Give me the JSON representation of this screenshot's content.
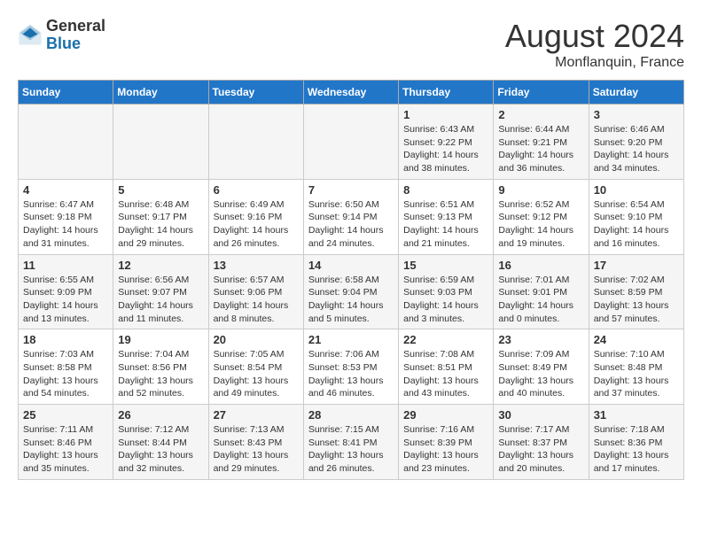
{
  "header": {
    "logo_general": "General",
    "logo_blue": "Blue",
    "month_year": "August 2024",
    "location": "Monflanquin, France"
  },
  "weekdays": [
    "Sunday",
    "Monday",
    "Tuesday",
    "Wednesday",
    "Thursday",
    "Friday",
    "Saturday"
  ],
  "weeks": [
    [
      {
        "day": "",
        "detail": ""
      },
      {
        "day": "",
        "detail": ""
      },
      {
        "day": "",
        "detail": ""
      },
      {
        "day": "",
        "detail": ""
      },
      {
        "day": "1",
        "detail": "Sunrise: 6:43 AM\nSunset: 9:22 PM\nDaylight: 14 hours\nand 38 minutes."
      },
      {
        "day": "2",
        "detail": "Sunrise: 6:44 AM\nSunset: 9:21 PM\nDaylight: 14 hours\nand 36 minutes."
      },
      {
        "day": "3",
        "detail": "Sunrise: 6:46 AM\nSunset: 9:20 PM\nDaylight: 14 hours\nand 34 minutes."
      }
    ],
    [
      {
        "day": "4",
        "detail": "Sunrise: 6:47 AM\nSunset: 9:18 PM\nDaylight: 14 hours\nand 31 minutes."
      },
      {
        "day": "5",
        "detail": "Sunrise: 6:48 AM\nSunset: 9:17 PM\nDaylight: 14 hours\nand 29 minutes."
      },
      {
        "day": "6",
        "detail": "Sunrise: 6:49 AM\nSunset: 9:16 PM\nDaylight: 14 hours\nand 26 minutes."
      },
      {
        "day": "7",
        "detail": "Sunrise: 6:50 AM\nSunset: 9:14 PM\nDaylight: 14 hours\nand 24 minutes."
      },
      {
        "day": "8",
        "detail": "Sunrise: 6:51 AM\nSunset: 9:13 PM\nDaylight: 14 hours\nand 21 minutes."
      },
      {
        "day": "9",
        "detail": "Sunrise: 6:52 AM\nSunset: 9:12 PM\nDaylight: 14 hours\nand 19 minutes."
      },
      {
        "day": "10",
        "detail": "Sunrise: 6:54 AM\nSunset: 9:10 PM\nDaylight: 14 hours\nand 16 minutes."
      }
    ],
    [
      {
        "day": "11",
        "detail": "Sunrise: 6:55 AM\nSunset: 9:09 PM\nDaylight: 14 hours\nand 13 minutes."
      },
      {
        "day": "12",
        "detail": "Sunrise: 6:56 AM\nSunset: 9:07 PM\nDaylight: 14 hours\nand 11 minutes."
      },
      {
        "day": "13",
        "detail": "Sunrise: 6:57 AM\nSunset: 9:06 PM\nDaylight: 14 hours\nand 8 minutes."
      },
      {
        "day": "14",
        "detail": "Sunrise: 6:58 AM\nSunset: 9:04 PM\nDaylight: 14 hours\nand 5 minutes."
      },
      {
        "day": "15",
        "detail": "Sunrise: 6:59 AM\nSunset: 9:03 PM\nDaylight: 14 hours\nand 3 minutes."
      },
      {
        "day": "16",
        "detail": "Sunrise: 7:01 AM\nSunset: 9:01 PM\nDaylight: 14 hours\nand 0 minutes."
      },
      {
        "day": "17",
        "detail": "Sunrise: 7:02 AM\nSunset: 8:59 PM\nDaylight: 13 hours\nand 57 minutes."
      }
    ],
    [
      {
        "day": "18",
        "detail": "Sunrise: 7:03 AM\nSunset: 8:58 PM\nDaylight: 13 hours\nand 54 minutes."
      },
      {
        "day": "19",
        "detail": "Sunrise: 7:04 AM\nSunset: 8:56 PM\nDaylight: 13 hours\nand 52 minutes."
      },
      {
        "day": "20",
        "detail": "Sunrise: 7:05 AM\nSunset: 8:54 PM\nDaylight: 13 hours\nand 49 minutes."
      },
      {
        "day": "21",
        "detail": "Sunrise: 7:06 AM\nSunset: 8:53 PM\nDaylight: 13 hours\nand 46 minutes."
      },
      {
        "day": "22",
        "detail": "Sunrise: 7:08 AM\nSunset: 8:51 PM\nDaylight: 13 hours\nand 43 minutes."
      },
      {
        "day": "23",
        "detail": "Sunrise: 7:09 AM\nSunset: 8:49 PM\nDaylight: 13 hours\nand 40 minutes."
      },
      {
        "day": "24",
        "detail": "Sunrise: 7:10 AM\nSunset: 8:48 PM\nDaylight: 13 hours\nand 37 minutes."
      }
    ],
    [
      {
        "day": "25",
        "detail": "Sunrise: 7:11 AM\nSunset: 8:46 PM\nDaylight: 13 hours\nand 35 minutes."
      },
      {
        "day": "26",
        "detail": "Sunrise: 7:12 AM\nSunset: 8:44 PM\nDaylight: 13 hours\nand 32 minutes."
      },
      {
        "day": "27",
        "detail": "Sunrise: 7:13 AM\nSunset: 8:43 PM\nDaylight: 13 hours\nand 29 minutes."
      },
      {
        "day": "28",
        "detail": "Sunrise: 7:15 AM\nSunset: 8:41 PM\nDaylight: 13 hours\nand 26 minutes."
      },
      {
        "day": "29",
        "detail": "Sunrise: 7:16 AM\nSunset: 8:39 PM\nDaylight: 13 hours\nand 23 minutes."
      },
      {
        "day": "30",
        "detail": "Sunrise: 7:17 AM\nSunset: 8:37 PM\nDaylight: 13 hours\nand 20 minutes."
      },
      {
        "day": "31",
        "detail": "Sunrise: 7:18 AM\nSunset: 8:36 PM\nDaylight: 13 hours\nand 17 minutes."
      }
    ]
  ]
}
